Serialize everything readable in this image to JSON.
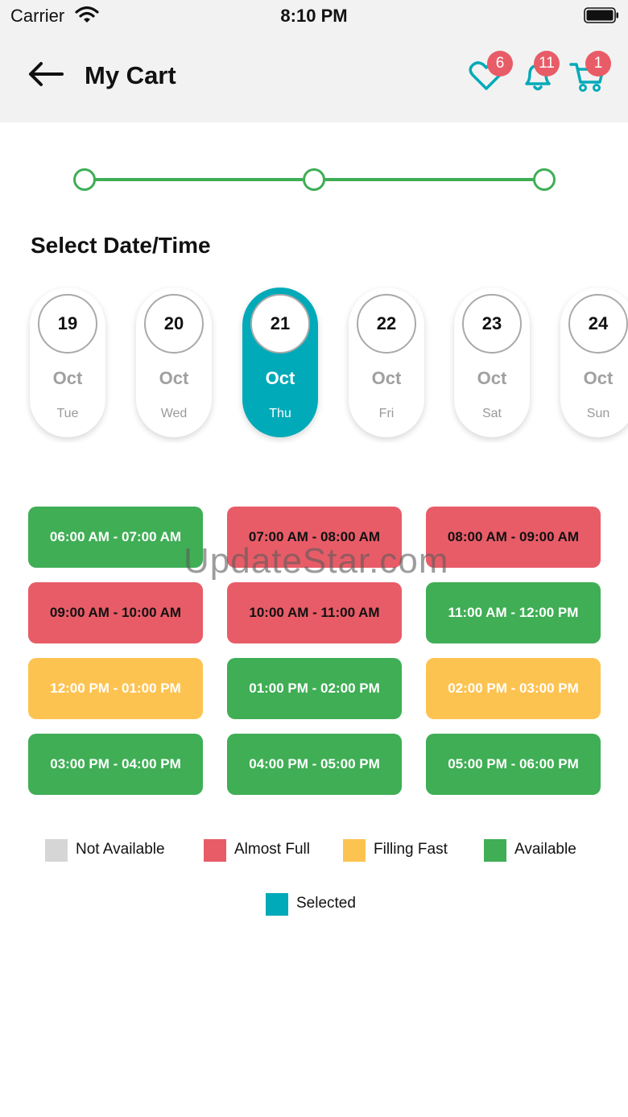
{
  "status_bar": {
    "carrier": "Carrier",
    "time": "8:10 PM"
  },
  "header": {
    "title": "My Cart",
    "wishlist_count": "6",
    "notification_count": "11",
    "cart_count": "1"
  },
  "section_title": "Select Date/Time",
  "dates": [
    {
      "day": "19",
      "month": "Oct",
      "weekday": "Tue",
      "selected": false
    },
    {
      "day": "20",
      "month": "Oct",
      "weekday": "Wed",
      "selected": false
    },
    {
      "day": "21",
      "month": "Oct",
      "weekday": "Thu",
      "selected": true
    },
    {
      "day": "22",
      "month": "Oct",
      "weekday": "Fri",
      "selected": false
    },
    {
      "day": "23",
      "month": "Oct",
      "weekday": "Sat",
      "selected": false
    },
    {
      "day": "24",
      "month": "Oct",
      "weekday": "Sun",
      "selected": false
    }
  ],
  "slots": [
    {
      "label": "06:00 AM - 07:00 AM",
      "status": "available"
    },
    {
      "label": "07:00 AM - 08:00 AM",
      "status": "almost_full"
    },
    {
      "label": "08:00 AM - 09:00 AM",
      "status": "almost_full"
    },
    {
      "label": "09:00 AM - 10:00 AM",
      "status": "almost_full"
    },
    {
      "label": "10:00 AM - 11:00 AM",
      "status": "almost_full"
    },
    {
      "label": "11:00 AM - 12:00 PM",
      "status": "available"
    },
    {
      "label": "12:00 PM - 01:00 PM",
      "status": "filling_fast"
    },
    {
      "label": "01:00 PM - 02:00 PM",
      "status": "available"
    },
    {
      "label": "02:00 PM - 03:00 PM",
      "status": "filling_fast"
    },
    {
      "label": "03:00 PM - 04:00 PM",
      "status": "available"
    },
    {
      "label": "04:00 PM - 05:00 PM",
      "status": "available"
    },
    {
      "label": "05:00 PM - 06:00 PM",
      "status": "available"
    }
  ],
  "legend": [
    {
      "label": "Not Available",
      "color": "#d6d6d6"
    },
    {
      "label": "Almost Full",
      "color": "#e85c68"
    },
    {
      "label": "Filling Fast",
      "color": "#fdc351"
    },
    {
      "label": "Available",
      "color": "#3fae55"
    },
    {
      "label": "Selected",
      "color": "#00aab8"
    }
  ],
  "watermark": "UpdateStar.com",
  "colors": {
    "accent": "#00aab8",
    "available": "#3fae55",
    "almost_full": "#e85c68",
    "filling_fast": "#fdc351",
    "badge": "#e85c68"
  }
}
